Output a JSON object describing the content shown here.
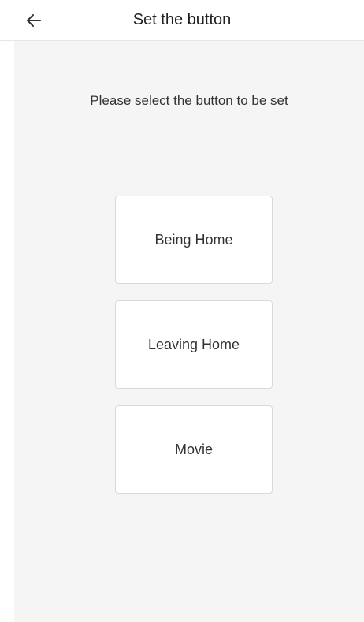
{
  "header": {
    "title": "Set the button",
    "back_icon": "arrow-left-icon"
  },
  "main": {
    "prompt": "Please select the button to be set",
    "buttons": [
      {
        "label": "Being Home"
      },
      {
        "label": "Leaving Home"
      },
      {
        "label": "Movie"
      }
    ]
  },
  "colors": {
    "background": "#f5f5f5",
    "header_bg": "#ffffff",
    "button_bg": "#ffffff",
    "button_border": "#d9d9d9",
    "text": "#333333"
  }
}
